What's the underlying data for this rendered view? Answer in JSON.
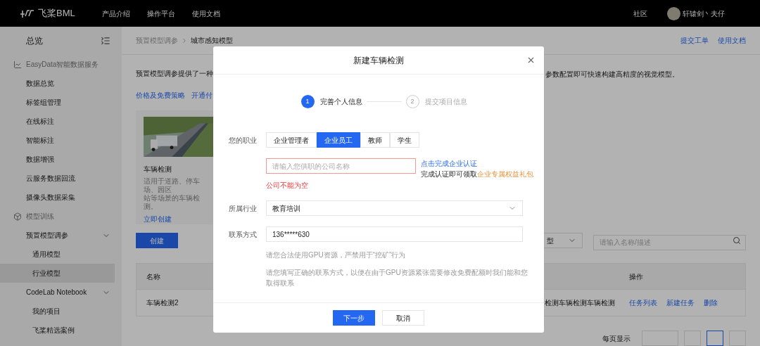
{
  "topnav": {
    "logo": "飞桨BML",
    "links": [
      "产品介绍",
      "操作平台",
      "使用文档"
    ],
    "community": "社区",
    "user": "轩辕剑丶夫仔"
  },
  "sidebar": {
    "title": "总览",
    "groups": [
      {
        "label": "EasyData智能数据服务",
        "items": [
          {
            "label": "数据总览",
            "selected": false
          },
          {
            "label": "标签组管理",
            "selected": false
          },
          {
            "label": "在线标注",
            "selected": false
          },
          {
            "label": "智能标注",
            "selected": false
          },
          {
            "label": "数据增强",
            "selected": false
          },
          {
            "label": "云服务数据回流",
            "selected": false
          },
          {
            "label": "摄像头数据采集",
            "selected": false
          }
        ]
      },
      {
        "label": "模型训练",
        "items": [
          {
            "label": "预置模型调参",
            "selected": false,
            "expanded": true,
            "children": [
              {
                "label": "通用模型",
                "selected": false
              },
              {
                "label": "行业模型",
                "selected": true
              }
            ]
          },
          {
            "label": "CodeLab Notebook",
            "selected": false,
            "expanded": true,
            "children": [
              {
                "label": "我的项目",
                "selected": false
              },
              {
                "label": "飞桨精选案例",
                "selected": false
              }
            ]
          }
        ]
      }
    ]
  },
  "breadcrumb": [
    "预置模型调参",
    "城市感知模型"
  ],
  "header_links": [
    "提交工单",
    "使用文档"
  ],
  "description_left": "预置模型调参提供了一种",
  "description_right": "参数配置即可快速构建高精度的视觉模型。",
  "links": [
    "价格及免费策略",
    "开通付"
  ],
  "card": {
    "kind": "picture",
    "title": "车辆检测",
    "desc_lines": [
      "适用于道路、停车场、园区",
      "站等场景的车辆检测。"
    ],
    "action": "立即创建"
  },
  "create_button": "创建",
  "type_filter": "型",
  "search": {
    "placeholder": "请输入名称/描述"
  },
  "table": {
    "columns": [
      "名称",
      "",
      "操作"
    ],
    "rows": [
      {
        "name": "车辆检测2",
        "desc": "检测车辆检测车辆检测",
        "actions": [
          "任务列表",
          "新建任务",
          "删除"
        ]
      }
    ]
  },
  "pager_label": "每页显示",
  "modal": {
    "title": "新建车辆检测",
    "steps": [
      {
        "number": "1",
        "label": "完善个人信息",
        "selected": true
      },
      {
        "number": "2",
        "label": "提交项目信息",
        "selected": false
      }
    ],
    "profession": {
      "label": "您的职业",
      "options": [
        {
          "label": "企业管理者",
          "selected": false
        },
        {
          "label": "企业员工",
          "selected": true
        },
        {
          "label": "教师",
          "selected": false
        },
        {
          "label": "学生",
          "selected": false
        }
      ]
    },
    "company": {
      "placeholder": "请输入您供职的公司名称",
      "error": true,
      "error_text": "公司不能为空",
      "cert_link": "点击完成企业认证",
      "cert_note": "完成认证即可领取",
      "cert_reward": "企业专属权益礼包"
    },
    "industry": {
      "label": "所属行业",
      "value": "教育培训"
    },
    "contact": {
      "label": "联系方式",
      "value": "136*****630"
    },
    "notes": [
      "请您合法使用GPU资源，严禁用于“挖矿”行为",
      "请您填写正确的联系方式，以便在由于GPU资源紧张需要修改免费配额时我们能和您取得联系"
    ],
    "buttons": [
      "下一步",
      "取消"
    ]
  }
}
